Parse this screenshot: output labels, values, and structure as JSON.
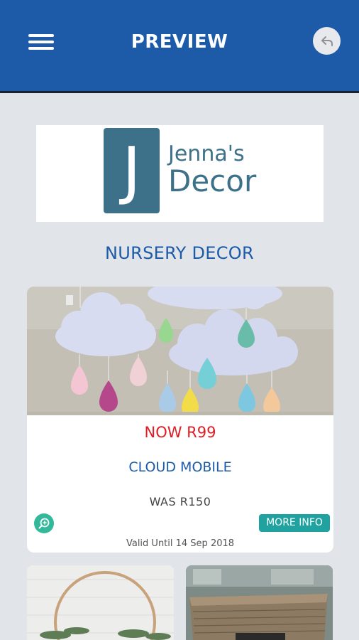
{
  "header": {
    "title": "PREVIEW",
    "menu_icon": "hamburger-menu-icon",
    "back_icon": "back-arrow-icon"
  },
  "logo": {
    "letter": "J",
    "line1": "Jenna's",
    "line2": "Decor"
  },
  "section": {
    "title": "NURSERY DECOR"
  },
  "product": {
    "now_price": "NOW R99",
    "name": "CLOUD MOBILE",
    "was_price": "WAS R150",
    "more_info_label": "MORE INFO",
    "valid_until": "Valid Until 14 Sep 2018",
    "zoom_icon": "zoom-icon"
  },
  "colors": {
    "brand_blue": "#1d5aa8",
    "price_red": "#e01d24",
    "teal": "#20a3a0",
    "logo_teal": "#3d7189"
  }
}
